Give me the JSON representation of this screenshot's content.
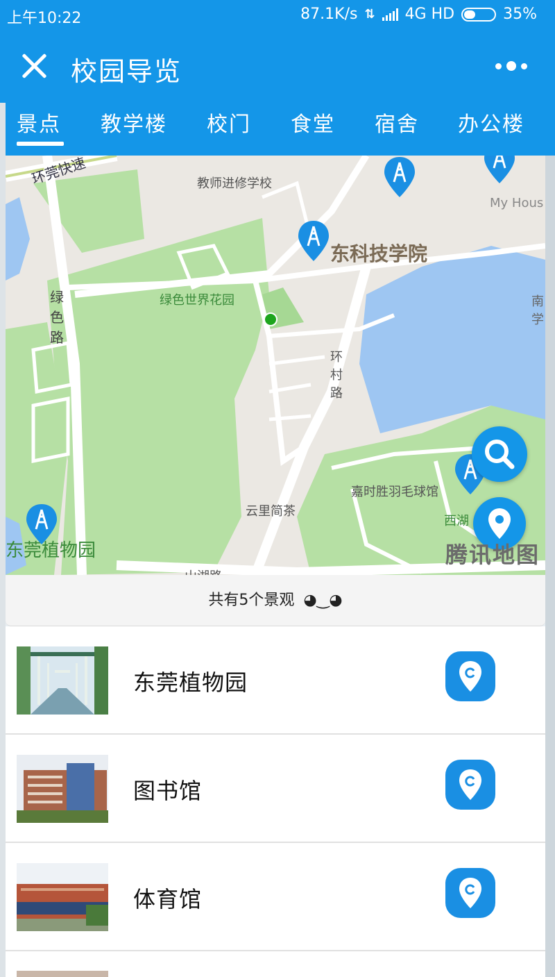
{
  "status_bar": {
    "time": "上午10:22",
    "speed": "87.1K/s",
    "network": "4G HD",
    "battery": "35%"
  },
  "navbar": {
    "title": "校园导览"
  },
  "tabs": [
    {
      "label": "景点"
    },
    {
      "label": "教学楼"
    },
    {
      "label": "校门"
    },
    {
      "label": "食堂"
    },
    {
      "label": "宿舍"
    },
    {
      "label": "办公楼"
    }
  ],
  "map": {
    "labels": {
      "highway": "环莞快速",
      "school": "教师进修学校",
      "house": "My Hous",
      "college": "东科技学院",
      "garden": "绿色世界花园",
      "road_green": "绿色路",
      "road_huancun": "环村路",
      "south": "南学",
      "teahouse": "云里简茶",
      "badminton": "嘉时胜羽毛球馆",
      "xihu": "西湖",
      "botanic": "东莞植物园",
      "shanhu": "山湖路"
    },
    "watermark": "腾讯地图"
  },
  "summary": {
    "text": "共有5个景观",
    "face": "◕‿◕"
  },
  "spots": [
    {
      "name": "东莞植物园"
    },
    {
      "name": "图书馆"
    },
    {
      "name": "体育馆"
    }
  ]
}
